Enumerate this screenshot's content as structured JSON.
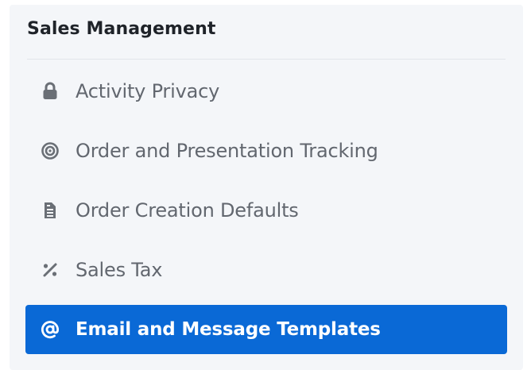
{
  "section": {
    "title": "Sales Management"
  },
  "menu": {
    "items": [
      {
        "label": "Activity Privacy",
        "icon": "lock-icon",
        "active": false
      },
      {
        "label": "Order and Presentation Tracking",
        "icon": "target-icon",
        "active": false
      },
      {
        "label": "Order Creation Defaults",
        "icon": "document-icon",
        "active": false
      },
      {
        "label": "Sales Tax",
        "icon": "percent-icon",
        "active": false
      },
      {
        "label": "Email and Message Templates",
        "icon": "at-sign-icon",
        "active": true
      }
    ]
  },
  "colors": {
    "panel_background": "#f4f6f9",
    "active_background": "#0a69d6",
    "text": "#62676f",
    "title": "#1f2329"
  }
}
